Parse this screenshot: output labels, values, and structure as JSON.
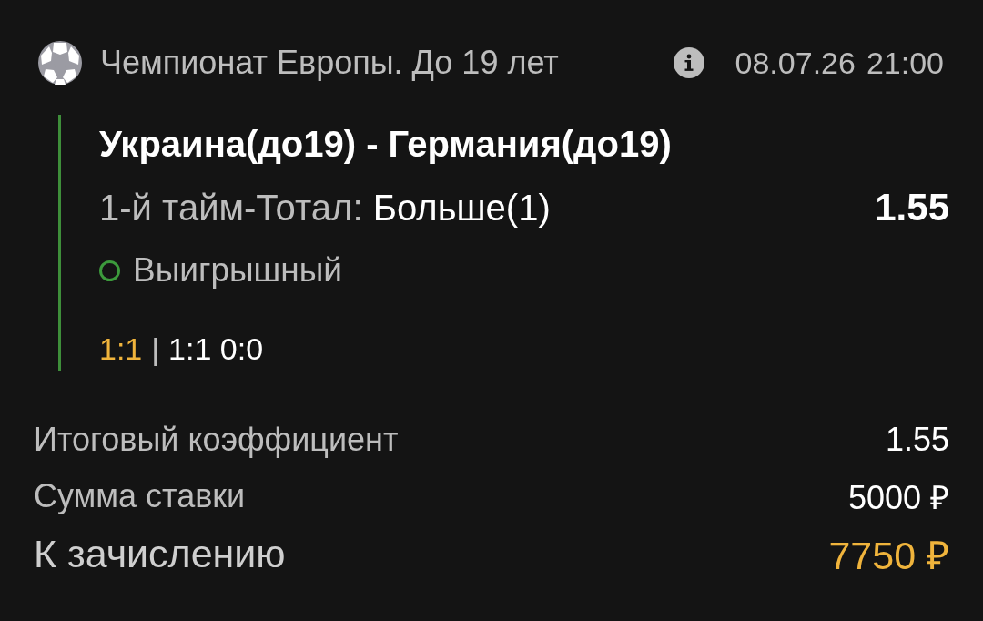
{
  "header": {
    "tournament": "Чемпионат Европы. До 19 лет",
    "date": "08.07.26",
    "time": "21:00"
  },
  "bet": {
    "match": "Украина(до19) - Германия(до19)",
    "market": "1-й тайм-Тотал:",
    "selection": "Больше(1)",
    "odds": "1.55",
    "status": {
      "label": "Выигрышный",
      "kind": "won"
    },
    "score": {
      "main": "1:1",
      "separator": "|",
      "periods": "1:1 0:0"
    }
  },
  "summary": [
    {
      "label": "Итоговый коэффициент",
      "value": "1.55",
      "kind": "normal"
    },
    {
      "label": "Сумма ставки",
      "value": "5000 ₽",
      "kind": "normal"
    },
    {
      "label": "К зачислению",
      "value": "7750 ₽",
      "kind": "payout"
    }
  ]
}
